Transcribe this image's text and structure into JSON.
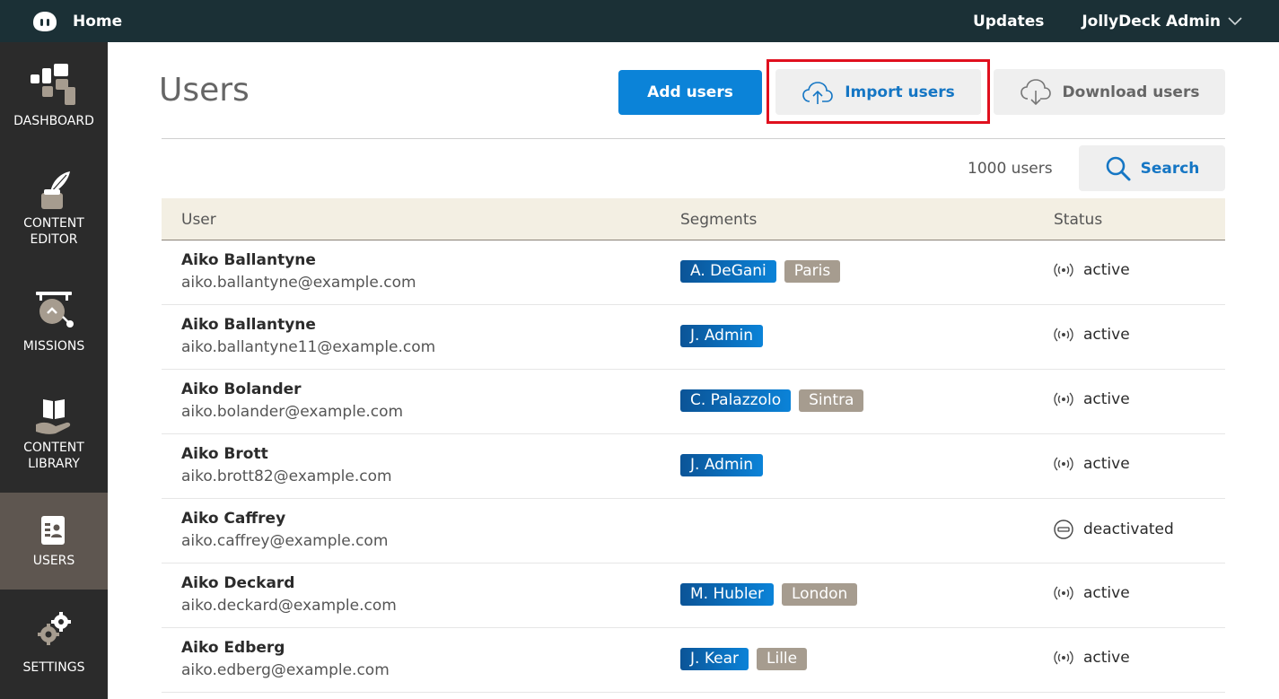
{
  "topbar": {
    "home_label": "Home",
    "updates_label": "Updates",
    "admin_label": "JollyDeck Admin"
  },
  "sidebar": {
    "items": [
      {
        "label_line1": "DASHBOARD",
        "label_line2": "",
        "icon": "dashboard-icon",
        "active": false
      },
      {
        "label_line1": "CONTENT",
        "label_line2": "EDITOR",
        "icon": "quill-icon",
        "active": false
      },
      {
        "label_line1": "MISSIONS",
        "label_line2": "",
        "icon": "gong-icon",
        "active": false
      },
      {
        "label_line1": "CONTENT",
        "label_line2": "LIBRARY",
        "icon": "book-hand-icon",
        "active": false
      },
      {
        "label_line1": "USERS",
        "label_line2": "",
        "icon": "user-card-icon",
        "active": true
      },
      {
        "label_line1": "SETTINGS",
        "label_line2": "",
        "icon": "gears-icon",
        "active": false
      }
    ]
  },
  "page": {
    "title": "Users",
    "add_users": "Add users",
    "import_users": "Import users",
    "download_users": "Download users",
    "user_count": "1000 users",
    "search": "Search"
  },
  "table": {
    "headers": {
      "user": "User",
      "segments": "Segments",
      "status": "Status"
    },
    "rows": [
      {
        "name": "Aiko Ballantyne",
        "email": "aiko.ballantyne@example.com",
        "seg1": "A. DeGani",
        "seg2": "Paris",
        "status": "active"
      },
      {
        "name": "Aiko Ballantyne",
        "email": "aiko.ballantyne11@example.com",
        "seg1": "J. Admin",
        "seg2": "",
        "status": "active"
      },
      {
        "name": "Aiko Bolander",
        "email": "aiko.bolander@example.com",
        "seg1": "C. Palazzolo",
        "seg2": "Sintra",
        "status": "active"
      },
      {
        "name": "Aiko Brott",
        "email": "aiko.brott82@example.com",
        "seg1": "J. Admin",
        "seg2": "",
        "status": "active"
      },
      {
        "name": "Aiko Caffrey",
        "email": "aiko.caffrey@example.com",
        "seg1": "",
        "seg2": "",
        "status": "deactivated"
      },
      {
        "name": "Aiko Deckard",
        "email": "aiko.deckard@example.com",
        "seg1": "M. Hubler",
        "seg2": "London",
        "status": "active"
      },
      {
        "name": "Aiko Edberg",
        "email": "aiko.edberg@example.com",
        "seg1": "J. Kear",
        "seg2": "Lille",
        "status": "active"
      }
    ]
  },
  "colors": {
    "topbar": "#1b3036",
    "sidebar": "#2b2b2b",
    "sidebar_active": "#5e5650",
    "primary": "#0b83d8",
    "highlight": "#e0101e",
    "tag_beige": "#a69c8f"
  }
}
